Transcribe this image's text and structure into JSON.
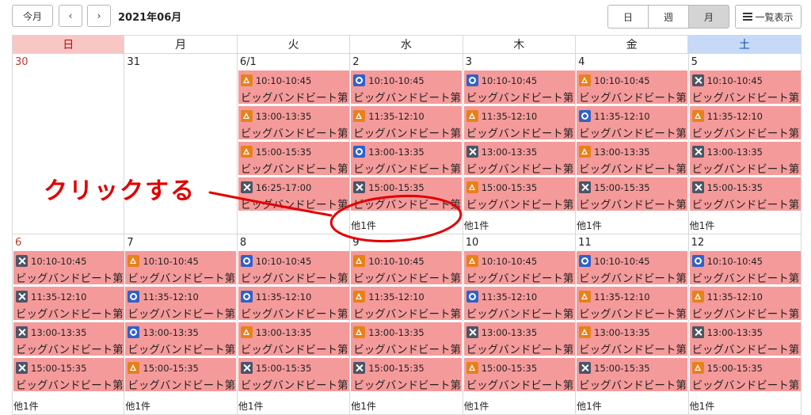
{
  "toolbar": {
    "today_label": "今月",
    "prev_symbol": "‹",
    "next_symbol": "›",
    "month_title": "2021年06月",
    "view_day_label": "日",
    "view_week_label": "週",
    "view_month_label": "月",
    "list_label": "一覧表示"
  },
  "weekdays": [
    "日",
    "月",
    "火",
    "水",
    "木",
    "金",
    "土"
  ],
  "event_title": "ビッグバンドビート第",
  "weeks": [
    {
      "days": [
        {
          "label": "30",
          "events": [],
          "more": ""
        },
        {
          "label": "31",
          "events": [],
          "more": ""
        },
        {
          "label": "6/1",
          "events": [
            {
              "mark": "triangle",
              "time": "10:10-10:45"
            },
            {
              "mark": "triangle",
              "time": "13:00-13:35"
            },
            {
              "mark": "triangle",
              "time": "15:00-15:35"
            },
            {
              "mark": "cross",
              "time": "16:25-17:00"
            }
          ],
          "more": ""
        },
        {
          "label": "2",
          "events": [
            {
              "mark": "circle",
              "time": "10:10-10:45"
            },
            {
              "mark": "triangle",
              "time": "11:35-12:10"
            },
            {
              "mark": "circle",
              "time": "13:00-13:35"
            },
            {
              "mark": "cross",
              "time": "15:00-15:35"
            }
          ],
          "more": "他1件"
        },
        {
          "label": "3",
          "events": [
            {
              "mark": "circle",
              "time": "10:10-10:45"
            },
            {
              "mark": "triangle",
              "time": "11:35-12:10"
            },
            {
              "mark": "cross",
              "time": "13:00-13:35"
            },
            {
              "mark": "triangle",
              "time": "15:00-15:35"
            }
          ],
          "more": "他1件"
        },
        {
          "label": "4",
          "events": [
            {
              "mark": "triangle",
              "time": "10:10-10:45"
            },
            {
              "mark": "circle",
              "time": "11:35-12:10"
            },
            {
              "mark": "triangle",
              "time": "13:00-13:35"
            },
            {
              "mark": "cross",
              "time": "15:00-15:35"
            }
          ],
          "more": "他1件"
        },
        {
          "label": "5",
          "events": [
            {
              "mark": "cross",
              "time": "10:10-10:45"
            },
            {
              "mark": "triangle",
              "time": "11:35-12:10"
            },
            {
              "mark": "cross",
              "time": "13:00-13:35"
            },
            {
              "mark": "cross",
              "time": "15:00-15:35"
            }
          ],
          "more": "他1件"
        }
      ]
    },
    {
      "days": [
        {
          "label": "6",
          "events": [
            {
              "mark": "cross",
              "time": "10:10-10:45"
            },
            {
              "mark": "cross",
              "time": "11:35-12:10"
            },
            {
              "mark": "cross",
              "time": "13:00-13:35"
            },
            {
              "mark": "cross",
              "time": "15:00-15:35"
            }
          ],
          "more": "他1件"
        },
        {
          "label": "7",
          "events": [
            {
              "mark": "triangle",
              "time": "10:10-10:45"
            },
            {
              "mark": "circle",
              "time": "11:35-12:10"
            },
            {
              "mark": "circle",
              "time": "13:00-13:35"
            },
            {
              "mark": "triangle",
              "time": "15:00-15:35"
            }
          ],
          "more": "他1件"
        },
        {
          "label": "8",
          "events": [
            {
              "mark": "circle",
              "time": "10:10-10:45"
            },
            {
              "mark": "circle",
              "time": "11:35-12:10"
            },
            {
              "mark": "triangle",
              "time": "13:00-13:35"
            },
            {
              "mark": "cross",
              "time": "15:00-15:35"
            }
          ],
          "more": "他1件"
        },
        {
          "label": "9",
          "events": [
            {
              "mark": "triangle",
              "time": "10:10-10:45"
            },
            {
              "mark": "triangle",
              "time": "11:35-12:10"
            },
            {
              "mark": "triangle",
              "time": "13:00-13:35"
            },
            {
              "mark": "cross",
              "time": "15:00-15:35"
            }
          ],
          "more": "他1件"
        },
        {
          "label": "10",
          "events": [
            {
              "mark": "triangle",
              "time": "10:10-10:45"
            },
            {
              "mark": "circle",
              "time": "11:35-12:10"
            },
            {
              "mark": "cross",
              "time": "13:00-13:35"
            },
            {
              "mark": "triangle",
              "time": "15:00-15:35"
            }
          ],
          "more": "他1件"
        },
        {
          "label": "11",
          "events": [
            {
              "mark": "circle",
              "time": "10:10-10:45"
            },
            {
              "mark": "triangle",
              "time": "11:35-12:10"
            },
            {
              "mark": "triangle",
              "time": "13:00-13:35"
            },
            {
              "mark": "cross",
              "time": "15:00-15:35"
            }
          ],
          "more": "他1件"
        },
        {
          "label": "12",
          "events": [
            {
              "mark": "circle",
              "time": "10:10-10:45"
            },
            {
              "mark": "triangle",
              "time": "11:35-12:10"
            },
            {
              "mark": "cross",
              "time": "13:00-13:35"
            },
            {
              "mark": "triangle",
              "time": "15:00-15:35"
            }
          ],
          "more": "他1件"
        }
      ]
    }
  ],
  "annotation": {
    "text": "クリックする",
    "color": "#e10000"
  },
  "colors": {
    "event_bg": "#f59a9a",
    "sunday_header": "#f9c6c6",
    "saturday_header": "#c6d9f7",
    "mark_triangle": "#e8811a",
    "mark_circle": "#2f62c9",
    "mark_cross": "#4a5566"
  }
}
